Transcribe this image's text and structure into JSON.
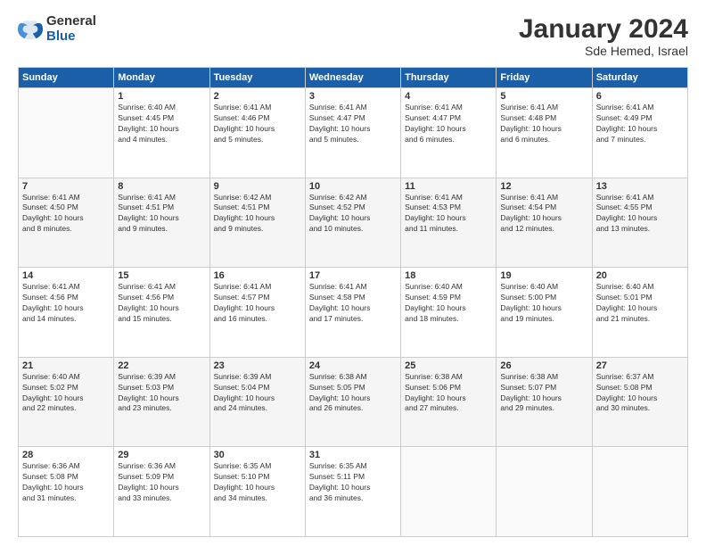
{
  "header": {
    "logo_general": "General",
    "logo_blue": "Blue",
    "title": "January 2024",
    "subtitle": "Sde Hemed, Israel"
  },
  "columns": [
    "Sunday",
    "Monday",
    "Tuesday",
    "Wednesday",
    "Thursday",
    "Friday",
    "Saturday"
  ],
  "weeks": [
    [
      {
        "day": "",
        "info": ""
      },
      {
        "day": "1",
        "info": "Sunrise: 6:40 AM\nSunset: 4:45 PM\nDaylight: 10 hours\nand 4 minutes."
      },
      {
        "day": "2",
        "info": "Sunrise: 6:41 AM\nSunset: 4:46 PM\nDaylight: 10 hours\nand 5 minutes."
      },
      {
        "day": "3",
        "info": "Sunrise: 6:41 AM\nSunset: 4:47 PM\nDaylight: 10 hours\nand 5 minutes."
      },
      {
        "day": "4",
        "info": "Sunrise: 6:41 AM\nSunset: 4:47 PM\nDaylight: 10 hours\nand 6 minutes."
      },
      {
        "day": "5",
        "info": "Sunrise: 6:41 AM\nSunset: 4:48 PM\nDaylight: 10 hours\nand 6 minutes."
      },
      {
        "day": "6",
        "info": "Sunrise: 6:41 AM\nSunset: 4:49 PM\nDaylight: 10 hours\nand 7 minutes."
      }
    ],
    [
      {
        "day": "7",
        "info": "Sunrise: 6:41 AM\nSunset: 4:50 PM\nDaylight: 10 hours\nand 8 minutes."
      },
      {
        "day": "8",
        "info": "Sunrise: 6:41 AM\nSunset: 4:51 PM\nDaylight: 10 hours\nand 9 minutes."
      },
      {
        "day": "9",
        "info": "Sunrise: 6:42 AM\nSunset: 4:51 PM\nDaylight: 10 hours\nand 9 minutes."
      },
      {
        "day": "10",
        "info": "Sunrise: 6:42 AM\nSunset: 4:52 PM\nDaylight: 10 hours\nand 10 minutes."
      },
      {
        "day": "11",
        "info": "Sunrise: 6:41 AM\nSunset: 4:53 PM\nDaylight: 10 hours\nand 11 minutes."
      },
      {
        "day": "12",
        "info": "Sunrise: 6:41 AM\nSunset: 4:54 PM\nDaylight: 10 hours\nand 12 minutes."
      },
      {
        "day": "13",
        "info": "Sunrise: 6:41 AM\nSunset: 4:55 PM\nDaylight: 10 hours\nand 13 minutes."
      }
    ],
    [
      {
        "day": "14",
        "info": "Sunrise: 6:41 AM\nSunset: 4:56 PM\nDaylight: 10 hours\nand 14 minutes."
      },
      {
        "day": "15",
        "info": "Sunrise: 6:41 AM\nSunset: 4:56 PM\nDaylight: 10 hours\nand 15 minutes."
      },
      {
        "day": "16",
        "info": "Sunrise: 6:41 AM\nSunset: 4:57 PM\nDaylight: 10 hours\nand 16 minutes."
      },
      {
        "day": "17",
        "info": "Sunrise: 6:41 AM\nSunset: 4:58 PM\nDaylight: 10 hours\nand 17 minutes."
      },
      {
        "day": "18",
        "info": "Sunrise: 6:40 AM\nSunset: 4:59 PM\nDaylight: 10 hours\nand 18 minutes."
      },
      {
        "day": "19",
        "info": "Sunrise: 6:40 AM\nSunset: 5:00 PM\nDaylight: 10 hours\nand 19 minutes."
      },
      {
        "day": "20",
        "info": "Sunrise: 6:40 AM\nSunset: 5:01 PM\nDaylight: 10 hours\nand 21 minutes."
      }
    ],
    [
      {
        "day": "21",
        "info": "Sunrise: 6:40 AM\nSunset: 5:02 PM\nDaylight: 10 hours\nand 22 minutes."
      },
      {
        "day": "22",
        "info": "Sunrise: 6:39 AM\nSunset: 5:03 PM\nDaylight: 10 hours\nand 23 minutes."
      },
      {
        "day": "23",
        "info": "Sunrise: 6:39 AM\nSunset: 5:04 PM\nDaylight: 10 hours\nand 24 minutes."
      },
      {
        "day": "24",
        "info": "Sunrise: 6:38 AM\nSunset: 5:05 PM\nDaylight: 10 hours\nand 26 minutes."
      },
      {
        "day": "25",
        "info": "Sunrise: 6:38 AM\nSunset: 5:06 PM\nDaylight: 10 hours\nand 27 minutes."
      },
      {
        "day": "26",
        "info": "Sunrise: 6:38 AM\nSunset: 5:07 PM\nDaylight: 10 hours\nand 29 minutes."
      },
      {
        "day": "27",
        "info": "Sunrise: 6:37 AM\nSunset: 5:08 PM\nDaylight: 10 hours\nand 30 minutes."
      }
    ],
    [
      {
        "day": "28",
        "info": "Sunrise: 6:36 AM\nSunset: 5:08 PM\nDaylight: 10 hours\nand 31 minutes."
      },
      {
        "day": "29",
        "info": "Sunrise: 6:36 AM\nSunset: 5:09 PM\nDaylight: 10 hours\nand 33 minutes."
      },
      {
        "day": "30",
        "info": "Sunrise: 6:35 AM\nSunset: 5:10 PM\nDaylight: 10 hours\nand 34 minutes."
      },
      {
        "day": "31",
        "info": "Sunrise: 6:35 AM\nSunset: 5:11 PM\nDaylight: 10 hours\nand 36 minutes."
      },
      {
        "day": "",
        "info": ""
      },
      {
        "day": "",
        "info": ""
      },
      {
        "day": "",
        "info": ""
      }
    ]
  ]
}
